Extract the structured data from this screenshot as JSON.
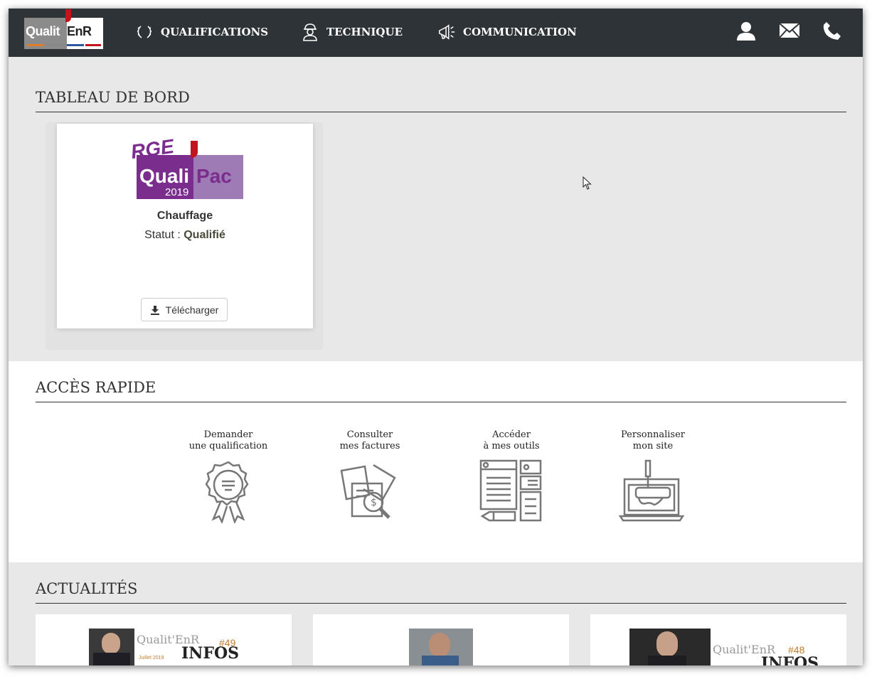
{
  "nav": {
    "logo_text_left": "Qualit",
    "logo_text_right": "EnR",
    "items": [
      {
        "label": "QUALIFICATIONS",
        "icon": "laurel-icon"
      },
      {
        "label": "TECHNIQUE",
        "icon": "worker-icon"
      },
      {
        "label": "COMMUNICATION",
        "icon": "megaphone-icon"
      }
    ],
    "right_icons": [
      "user-icon",
      "mail-icon",
      "phone-icon"
    ]
  },
  "dashboard": {
    "title": "TABLEAU DE BORD",
    "card": {
      "badge_rge": "RGE",
      "badge_brand": "QualiPac",
      "badge_brand_left": "Quali",
      "badge_brand_right": "Pac",
      "badge_year": "2019",
      "name": "Chauffage",
      "status_label": "Statut : ",
      "status_value": "Qualifié",
      "download_label": "Télécharger"
    }
  },
  "quick_access": {
    "title": "ACCÈS RAPIDE",
    "items": [
      {
        "line1": "Demander",
        "line2": "une qualification",
        "icon": "certificate-icon"
      },
      {
        "line1": "Consulter",
        "line2": "mes factures",
        "icon": "invoice-search-icon"
      },
      {
        "line1": "Accéder",
        "line2": "à mes outils",
        "icon": "tools-icon"
      },
      {
        "line1": "Personnaliser",
        "line2": "mon site",
        "icon": "website-paint-icon"
      }
    ]
  },
  "news": {
    "title": "ACTUALITÉS",
    "items": [
      {
        "brand": "Qualit'EnR",
        "issue": "#49",
        "subtitle": "INFOS",
        "date": "Juillet 2019"
      },
      {
        "brand": "",
        "issue": "",
        "subtitle": "",
        "date": ""
      },
      {
        "brand": "Qualit'EnR",
        "issue": "#48",
        "subtitle": "INFOS",
        "date": ""
      }
    ]
  },
  "colors": {
    "nav_bg": "#2e3337",
    "accent_red": "#c3141e",
    "badge_purple": "#7b2d8e",
    "page_bg": "#e8e8e8"
  }
}
